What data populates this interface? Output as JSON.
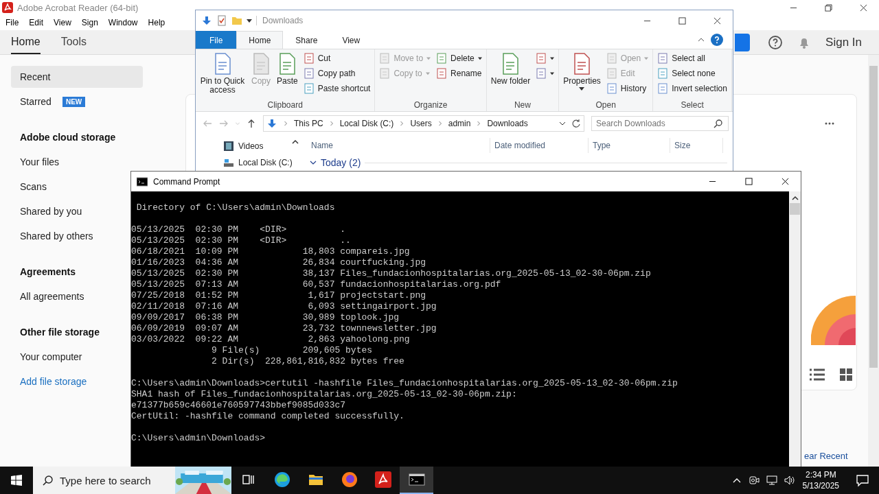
{
  "acrobat": {
    "title": "Adobe Acrobat Reader (64-bit)",
    "menu": [
      "File",
      "Edit",
      "View",
      "Sign",
      "Window",
      "Help"
    ],
    "tabs": [
      {
        "label": "Home",
        "selected": true
      },
      {
        "label": "Tools",
        "selected": false
      }
    ],
    "sign_in": "Sign In",
    "sidebar": [
      {
        "kind": "item",
        "label": "Recent",
        "selected": true
      },
      {
        "kind": "item",
        "label": "Starred",
        "selected": false,
        "badge": "NEW"
      },
      {
        "kind": "heading",
        "label": "Adobe cloud storage"
      },
      {
        "kind": "item",
        "label": "Your files",
        "selected": false
      },
      {
        "kind": "item",
        "label": "Scans",
        "selected": false
      },
      {
        "kind": "item",
        "label": "Shared by you",
        "selected": false
      },
      {
        "kind": "item",
        "label": "Shared by others",
        "selected": false
      },
      {
        "kind": "heading",
        "label": "Agreements"
      },
      {
        "kind": "item",
        "label": "All agreements",
        "selected": false
      },
      {
        "kind": "heading",
        "label": "Other file storage"
      },
      {
        "kind": "item",
        "label": "Your computer",
        "selected": false
      },
      {
        "kind": "link",
        "label": "Add file storage",
        "selected": false
      }
    ],
    "clear_recent": "ear Recent"
  },
  "explorer": {
    "title": "Downloads",
    "ribbon_tabs": [
      {
        "label": "File",
        "kind": "file",
        "selected": false
      },
      {
        "label": "Home",
        "kind": "tab",
        "selected": true
      },
      {
        "label": "Share",
        "kind": "tab",
        "selected": false
      },
      {
        "label": "View",
        "kind": "tab",
        "selected": false
      }
    ],
    "groups": [
      {
        "label": "Clipboard",
        "columns": [
          [
            {
              "label": "Pin to Quick access",
              "disabled": false,
              "dropdown": false
            }
          ],
          [
            {
              "label": "Copy",
              "disabled": true,
              "dropdown": false
            }
          ],
          [
            {
              "label": "Paste",
              "disabled": false,
              "dropdown": false
            }
          ],
          [
            {
              "label": "Cut",
              "disabled": false,
              "dropdown": false
            },
            {
              "label": "Copy path",
              "disabled": false,
              "dropdown": false
            },
            {
              "label": "Paste shortcut",
              "disabled": false,
              "dropdown": false
            }
          ]
        ]
      },
      {
        "label": "Organize",
        "columns": [
          [
            {
              "label": "Move to",
              "disabled": true,
              "dropdown": true
            },
            {
              "label": "Copy to",
              "disabled": true,
              "dropdown": true
            }
          ],
          [
            {
              "label": "Delete",
              "disabled": false,
              "dropdown": true
            },
            {
              "label": "Rename",
              "disabled": false,
              "dropdown": false
            }
          ]
        ]
      },
      {
        "label": "New",
        "columns": [
          [
            {
              "label": "New folder",
              "disabled": false,
              "dropdown": false
            }
          ],
          [
            {
              "disabled": false,
              "dropdown": true
            },
            {
              "disabled": false,
              "dropdown": true
            }
          ]
        ]
      },
      {
        "label": "Open",
        "columns": [
          [
            {
              "label": "Properties",
              "disabled": false,
              "dropdown": true
            }
          ],
          [
            {
              "label": "Open",
              "disabled": true,
              "dropdown": true
            },
            {
              "label": "Edit",
              "disabled": true,
              "dropdown": false
            },
            {
              "label": "History",
              "disabled": false,
              "dropdown": false
            }
          ]
        ]
      },
      {
        "label": "Select",
        "columns": [
          [
            {
              "label": "Select all",
              "disabled": false,
              "dropdown": false
            },
            {
              "label": "Select none",
              "disabled": false,
              "dropdown": false
            },
            {
              "label": "Invert selection",
              "disabled": false,
              "dropdown": false
            }
          ]
        ]
      }
    ],
    "breadcrumb": [
      "This PC",
      "Local Disk (C:)",
      "Users",
      "admin",
      "Downloads"
    ],
    "search": {
      "placeholder": "Search Downloads"
    },
    "nav": [
      "Videos",
      "Local Disk (C:)"
    ],
    "columns": [
      "Name",
      "Date modified",
      "Type",
      "Size"
    ],
    "group_header": "Today (2)"
  },
  "cmd": {
    "title": "Command Prompt",
    "blocks": [
      [
        " Directory of C:\\Users\\admin\\Downloads"
      ],
      [
        "05/13/2025  02:30 PM    <DIR>          .",
        "05/13/2025  02:30 PM    <DIR>          ..",
        "06/18/2021  10:09 PM            18,803 compareis.jpg",
        "01/16/2023  04:36 AM            26,834 courtfucking.jpg",
        "05/13/2025  02:30 PM            38,137 Files_fundacionhospitalarias.org_2025-05-13_02-30-06pm.zip",
        "05/13/2025  07:13 AM            60,537 fundacionhospitalarias.org.pdf",
        "07/25/2018  01:52 PM             1,617 projectstart.png",
        "02/11/2018  07:16 AM             6,093 settingairport.jpg",
        "09/09/2017  06:38 PM            30,989 toplook.jpg",
        "06/09/2019  09:07 AM            23,732 townnewsletter.jpg",
        "03/03/2022  09:22 AM             2,863 yahoolong.png",
        "               9 File(s)        209,605 bytes",
        "               2 Dir(s)  228,861,816,832 bytes free"
      ],
      [
        "C:\\Users\\admin\\Downloads>certutil -hashfile Files_fundacionhospitalarias.org_2025-05-13_02-30-06pm.zip",
        "SHA1 hash of Files_fundacionhospitalarias.org_2025-05-13_02-30-06pm.zip:",
        "e71377b659c46601e760597743bbef9085d033c7",
        "CertUtil: -hashfile command completed successfully."
      ],
      [
        "C:\\Users\\admin\\Downloads>"
      ]
    ]
  },
  "taskbar": {
    "search": {
      "placeholder": "Type here to search"
    },
    "apps": [
      {
        "kind": "task-view",
        "active": false
      },
      {
        "kind": "browser-blue",
        "active": false
      },
      {
        "kind": "folder",
        "active": false
      },
      {
        "kind": "browser-orange",
        "active": false
      },
      {
        "kind": "pdf",
        "active": false
      },
      {
        "kind": "terminal",
        "active": true
      }
    ],
    "time": "2:34 PM",
    "date": "5/13/2025"
  }
}
